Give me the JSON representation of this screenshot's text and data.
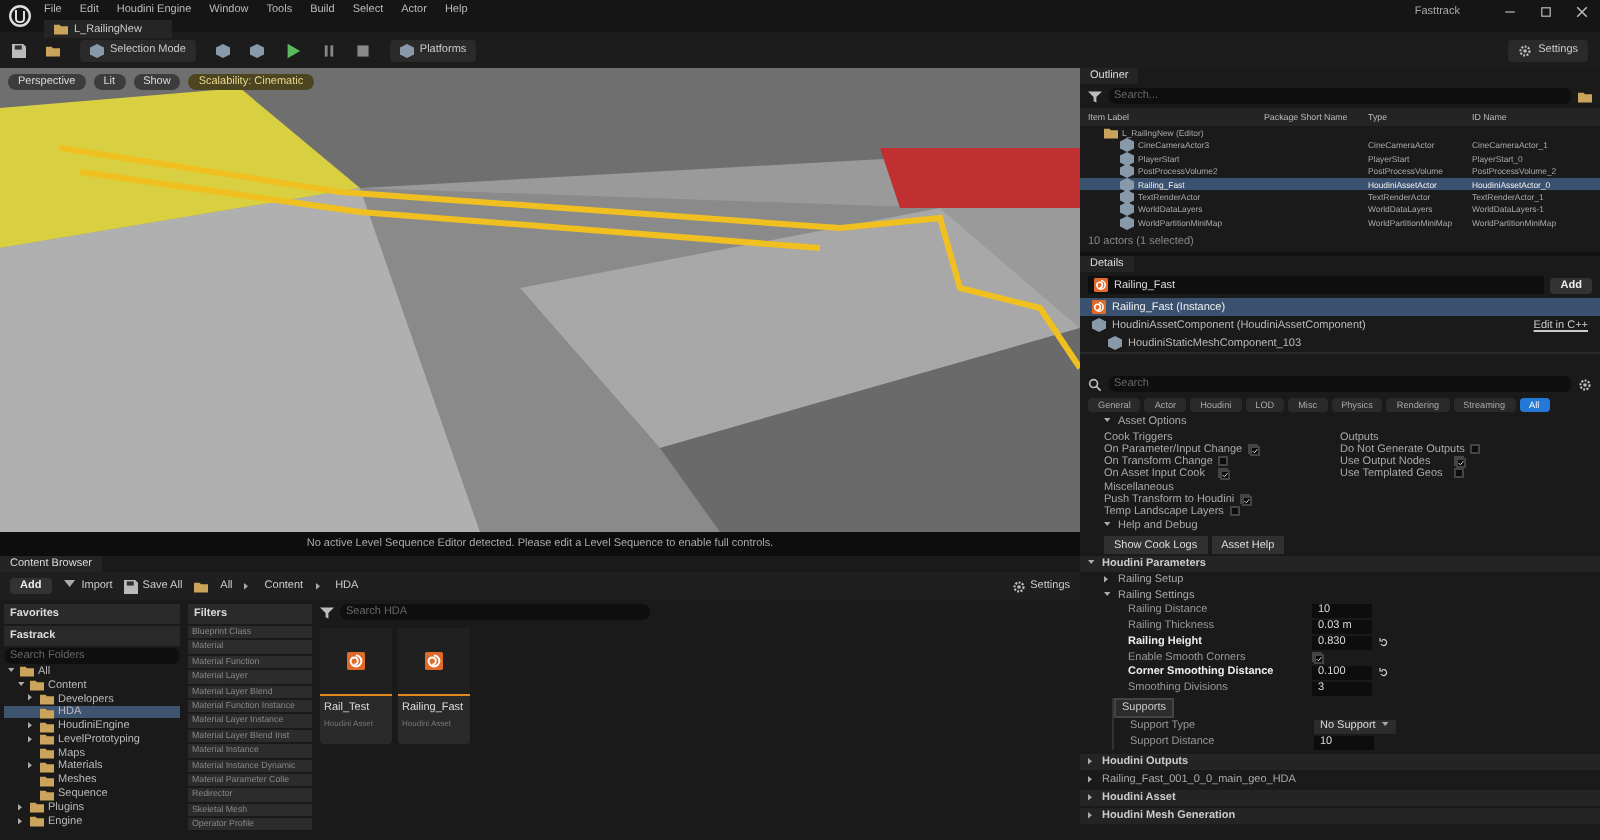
{
  "menu": [
    "File",
    "Edit",
    "Houdini Engine",
    "Window",
    "Tools",
    "Build",
    "Select",
    "Actor",
    "Help"
  ],
  "level_tab": "L_RailingNew",
  "feedback": "Fasttrack",
  "toolbar": {
    "mode": "Selection Mode",
    "platforms": "Platforms",
    "settings": "Settings"
  },
  "viewport": {
    "buttons": [
      "Perspective",
      "Lit",
      "Show"
    ],
    "scalability": "Scalability: Cinematic",
    "message": "No active Level Sequence Editor detected. Please edit a Level Sequence to enable full controls."
  },
  "outliner": {
    "title": "Outliner",
    "search": {
      "placeholder": "Search..."
    },
    "columns": [
      "Item Label",
      "Package Short Name",
      "Type",
      "ID Name"
    ],
    "rows": [
      {
        "kind": "folder",
        "label": "L_RailingNew (Editor)",
        "selected": false
      },
      {
        "kind": "actor",
        "label": "CineCameraActor3",
        "type": "CineCameraActor",
        "id_name": "CineCameraActor_1",
        "selected": false
      },
      {
        "kind": "actor",
        "label": "PlayerStart",
        "type": "PlayerStart",
        "id_name": "PlayerStart_0",
        "selected": false
      },
      {
        "kind": "actor",
        "label": "PostProcessVolume2",
        "type": "PostProcessVolume",
        "id_name": "PostProcessVolume_2",
        "selected": false
      },
      {
        "kind": "actor",
        "label": "Railing_Fast",
        "type": "HoudiniAssetActor",
        "id_name": "HoudiniAssetActor_0",
        "selected": true
      },
      {
        "kind": "actor",
        "label": "TextRenderActor",
        "type": "TextRenderActor",
        "id_name": "TextRenderActor_1",
        "selected": false
      },
      {
        "kind": "actor",
        "label": "WorldDataLayers",
        "type": "WorldDataLayers",
        "id_name": "WorldDataLayers-1",
        "selected": false
      },
      {
        "kind": "actor",
        "label": "WorldPartitionMiniMap",
        "type": "WorldPartitionMiniMap",
        "id_name": "WorldPartitionMiniMap",
        "selected": false
      }
    ],
    "status": "10 actors (1 selected)"
  },
  "details": {
    "title": "Details",
    "actor": "Railing_Fast",
    "add": "Add",
    "components": [
      {
        "label": "Railing_Fast (Instance)",
        "selected": true
      },
      {
        "label": "HoudiniAssetComponent (HoudiniAssetComponent)",
        "link": "Edit in C++",
        "selected": false
      },
      {
        "label": "HoudiniStaticMeshComponent_103",
        "selected": false
      }
    ],
    "search": {
      "placeholder": "Search"
    },
    "tabs": [
      {
        "label": "General",
        "selected": false
      },
      {
        "label": "Actor",
        "selected": false
      },
      {
        "label": "Houdini",
        "selected": false
      },
      {
        "label": "LOD",
        "selected": false
      },
      {
        "label": "Misc",
        "selected": false
      },
      {
        "label": "Physics",
        "selected": false
      },
      {
        "label": "Rendering",
        "selected": false
      },
      {
        "label": "Streaming",
        "selected": false
      },
      {
        "label": "All",
        "selected": true
      }
    ],
    "asset_options": {
      "title": "Asset Options",
      "groups": [
        {
          "heading": "Cook Triggers",
          "items": [
            {
              "label": "On Parameter/Input Change",
              "checked": true
            },
            {
              "label": "On Transform Change",
              "checked": false
            },
            {
              "label": "On Asset Input Cook",
              "checked": true
            }
          ]
        },
        {
          "heading": "Outputs",
          "items": [
            {
              "label": "Do Not Generate Outputs",
              "checked": false
            },
            {
              "label": "Use Output Nodes",
              "checked": true
            },
            {
              "label": "Use Templated Geos",
              "checked": false
            }
          ]
        },
        {
          "heading": "Miscellaneous",
          "items": [
            {
              "label": "Push Transform to Houdini",
              "checked": true
            },
            {
              "label": "Temp Landscape Layers",
              "checked": false
            }
          ]
        }
      ]
    },
    "help": {
      "title": "Help and Debug",
      "buttons": [
        "Show Cook Logs",
        "Asset Help"
      ]
    },
    "parameters": {
      "title": "Houdini Parameters",
      "folders": [
        {
          "label": "Railing Setup",
          "expanded": false
        },
        {
          "label": "Railing Settings",
          "expanded": true
        }
      ],
      "params": [
        {
          "kind": "number",
          "label": "Railing Distance",
          "value": "10",
          "modified": false
        },
        {
          "kind": "number",
          "label": "Railing Thickness",
          "value": "0.03 m",
          "modified": false
        },
        {
          "kind": "number",
          "label": "Railing Height",
          "value": "0.830",
          "modified": true
        },
        {
          "kind": "check",
          "label": "Enable Smooth Corners",
          "checked": true,
          "modified": false
        },
        {
          "kind": "number",
          "label": "Corner Smoothing Distance",
          "value": "0.100",
          "modified": true
        },
        {
          "kind": "number",
          "label": "Smoothing Divisions",
          "value": "3",
          "modified": false
        }
      ],
      "supports": {
        "tab": "Supports",
        "params": [
          {
            "kind": "dropdown",
            "label": "Support Type",
            "value": "No Support",
            "modified": false
          },
          {
            "kind": "number",
            "label": "Support Distance",
            "value": "10",
            "modified": false
          }
        ]
      }
    },
    "bottom": [
      {
        "kind": "section",
        "label": "Houdini Outputs"
      },
      {
        "kind": "item",
        "label": "Railing_Fast_001_0_0_main_geo_HDA"
      },
      {
        "kind": "section",
        "label": "Houdini Asset"
      },
      {
        "kind": "section",
        "label": "Houdini Mesh Generation"
      }
    ]
  },
  "content_browser": {
    "title": "Content Browser",
    "add": "Add",
    "import": "Import",
    "save_all": "Save All",
    "path": [
      "All",
      "Content",
      "HDA"
    ],
    "settings": "Settings",
    "favorites": "Favorites",
    "project": "Fastrack",
    "folder_search": {
      "placeholder": "Search Folders"
    },
    "tree": [
      {
        "label": "All",
        "expanded": true,
        "selected": false,
        "children": [
          {
            "label": "Content",
            "expanded": true,
            "selected": false,
            "children": [
              {
                "label": "Developers",
                "expanded": false,
                "selected": false
              },
              {
                "label": "HDA",
                "selected": true
              },
              {
                "label": "HoudiniEngine",
                "expanded": false,
                "selected": false
              },
              {
                "label": "LevelPrototyping",
                "expanded": false,
                "selected": false
              },
              {
                "label": "Maps",
                "selected": false
              },
              {
                "label": "Materials",
                "expanded": false,
                "selected": false
              },
              {
                "label": "Meshes",
                "selected": false
              },
              {
                "label": "Sequence",
                "selected": false
              }
            ]
          },
          {
            "label": "Plugins",
            "expanded": false,
            "selected": false
          },
          {
            "label": "Engine",
            "expanded": false,
            "selected": false
          }
        ]
      }
    ],
    "filters_title": "Filters",
    "filters": [
      "Blueprint Class",
      "Material",
      "Material Function",
      "Material Layer",
      "Material Layer Blend",
      "Material Function Instance",
      "Material Layer Instance",
      "Material Layer Blend Inst",
      "Material Instance",
      "Material Instance Dynamic",
      "Material Parameter Colle",
      "Redirector",
      "Skeletal Mesh",
      "Operator Profile"
    ],
    "search": {
      "placeholder": "Search HDA"
    },
    "assets": [
      {
        "name": "Rail_Test",
        "type": "Houdini Asset"
      },
      {
        "name": "Railing_Fast",
        "type": "Houdini Asset"
      }
    ]
  }
}
